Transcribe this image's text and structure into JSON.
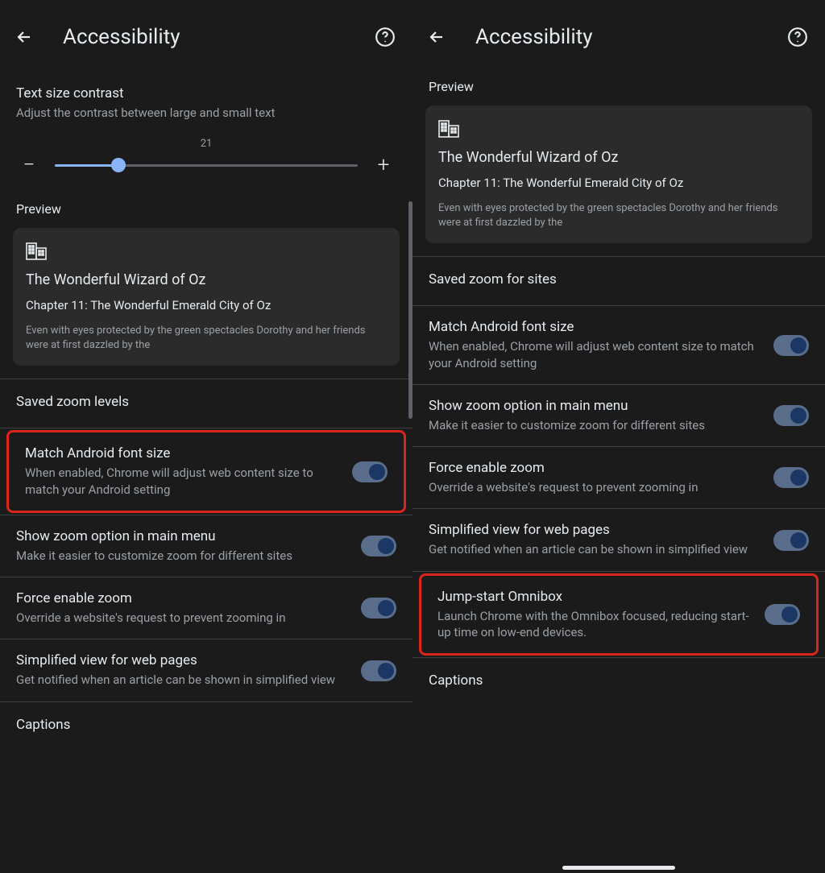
{
  "left": {
    "title": "Accessibility",
    "textSize": {
      "title": "Text size contrast",
      "subtitle": "Adjust the contrast between large and small text",
      "value": "21"
    },
    "previewLabel": "Preview",
    "preview": {
      "title": "The Wonderful Wizard of Oz",
      "chapter": "Chapter 11: The Wonderful Emerald City of Oz",
      "body": "Even with eyes protected by the green spectacles Dorothy and her friends were at first dazzled by the"
    },
    "savedZoom": "Saved zoom levels",
    "settings": {
      "matchFont": {
        "title": "Match Android font size",
        "sub": "When enabled, Chrome will adjust web content size to match your Android setting"
      },
      "showZoom": {
        "title": "Show zoom option in main menu",
        "sub": "Make it easier to customize zoom for different sites"
      },
      "forceZoom": {
        "title": "Force enable zoom",
        "sub": "Override a website's request to prevent zooming in"
      },
      "simplified": {
        "title": "Simplified view for web pages",
        "sub": "Get notified when an article can be shown in simplified view"
      },
      "captions": "Captions"
    }
  },
  "right": {
    "title": "Accessibility",
    "previewLabel": "Preview",
    "preview": {
      "title": "The Wonderful Wizard of Oz",
      "chapter": "Chapter 11: The Wonderful Emerald City of Oz",
      "body": "Even with eyes protected by the green spectacles Dorothy and her friends were at first dazzled by the"
    },
    "savedZoom": "Saved zoom for sites",
    "settings": {
      "matchFont": {
        "title": "Match Android font size",
        "sub": "When enabled, Chrome will adjust web content size to match your Android setting"
      },
      "showZoom": {
        "title": "Show zoom option in main menu",
        "sub": "Make it easier to customize zoom for different sites"
      },
      "forceZoom": {
        "title": "Force enable zoom",
        "sub": "Override a website's request to prevent zooming in"
      },
      "simplified": {
        "title": "Simplified view for web pages",
        "sub": "Get notified when an article can be shown in simplified view"
      },
      "jumpstart": {
        "title": "Jump-start Omnibox",
        "sub": "Launch Chrome with the Omnibox focused, reducing start-up time on low-end devices."
      },
      "captions": "Captions"
    }
  }
}
